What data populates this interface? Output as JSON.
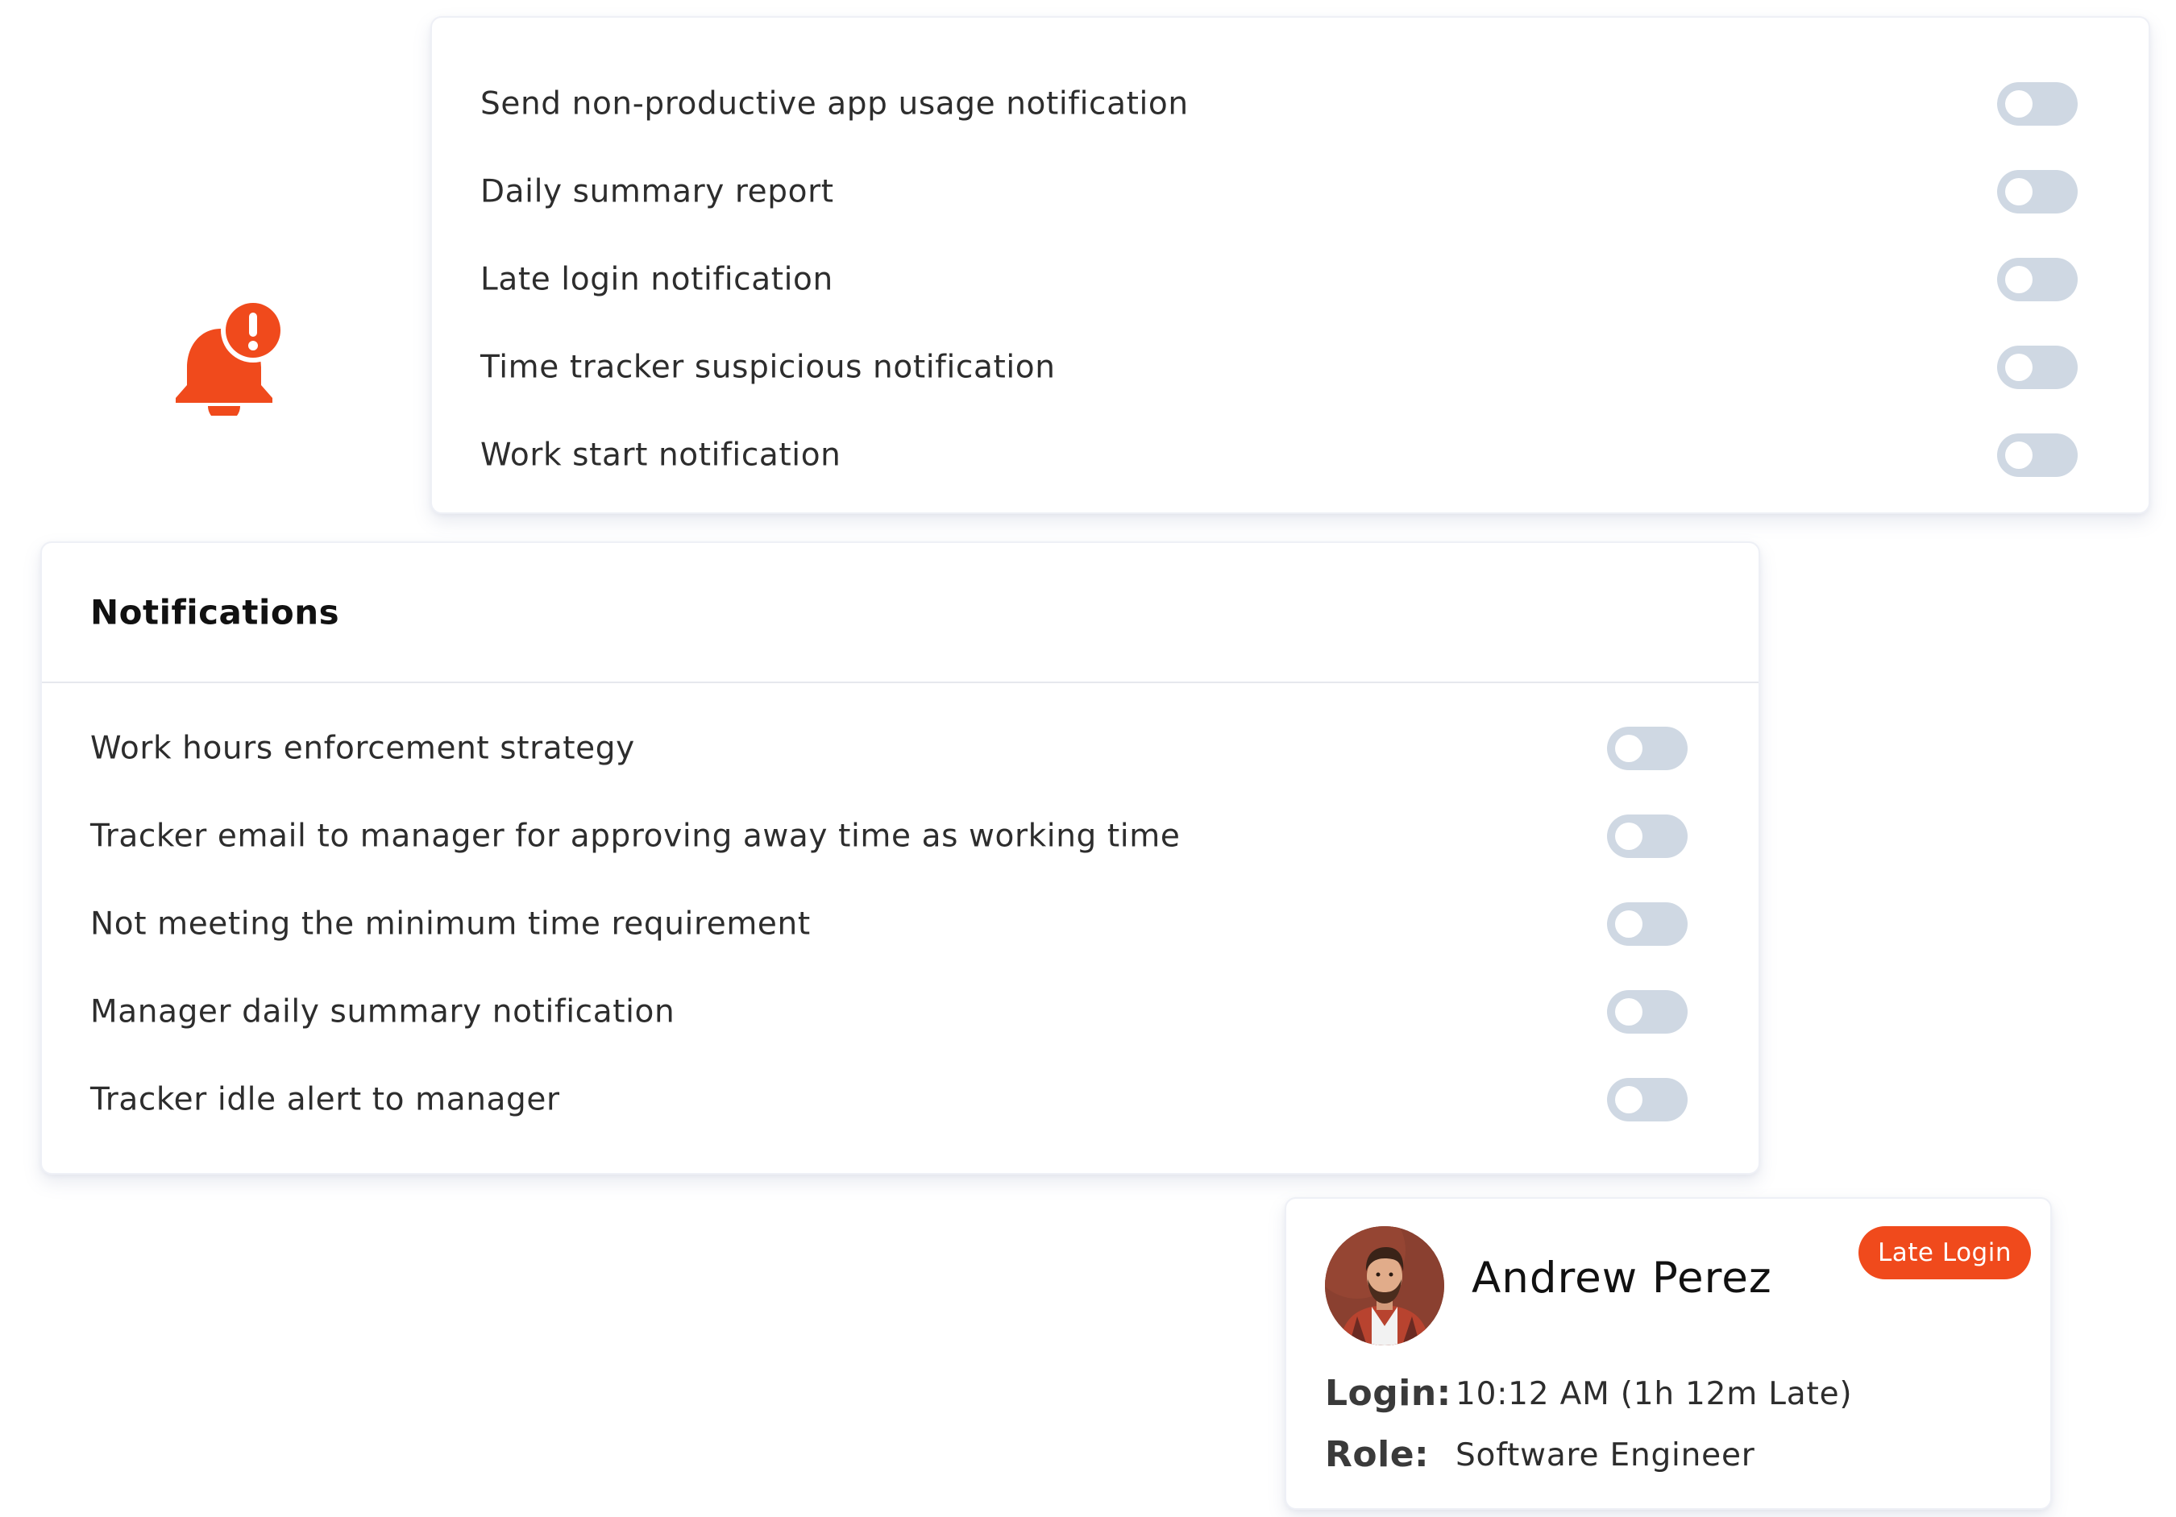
{
  "top_card": {
    "settings": [
      {
        "label": "Send non-productive app usage notification",
        "enabled": false
      },
      {
        "label": "Daily summary report",
        "enabled": false
      },
      {
        "label": "Late login notification",
        "enabled": false
      },
      {
        "label": "Time tracker suspicious notification",
        "enabled": false
      },
      {
        "label": "Work start notification",
        "enabled": false
      }
    ]
  },
  "notifications_card": {
    "title": "Notifications",
    "settings": [
      {
        "label": "Work hours enforcement strategy",
        "enabled": false
      },
      {
        "label": "Tracker email to manager for approving away time as working time",
        "enabled": false
      },
      {
        "label": "Not meeting the minimum time requirement",
        "enabled": false
      },
      {
        "label": "Manager daily summary notification",
        "enabled": false
      },
      {
        "label": "Tracker idle alert to manager",
        "enabled": false
      }
    ]
  },
  "profile_card": {
    "name": "Andrew Perez",
    "badge": "Late Login",
    "login_label": "Login:",
    "login_value": "10:12 AM  (1h 12m Late)",
    "role_label": "Role:",
    "role_value": "Software Engineer"
  },
  "icons": {
    "bell": "bell-alert-icon",
    "avatar": "avatar"
  },
  "colors": {
    "accent": "#f04a1c",
    "toggle_off": "#cfd8e3",
    "card_border": "#eef0f6"
  }
}
